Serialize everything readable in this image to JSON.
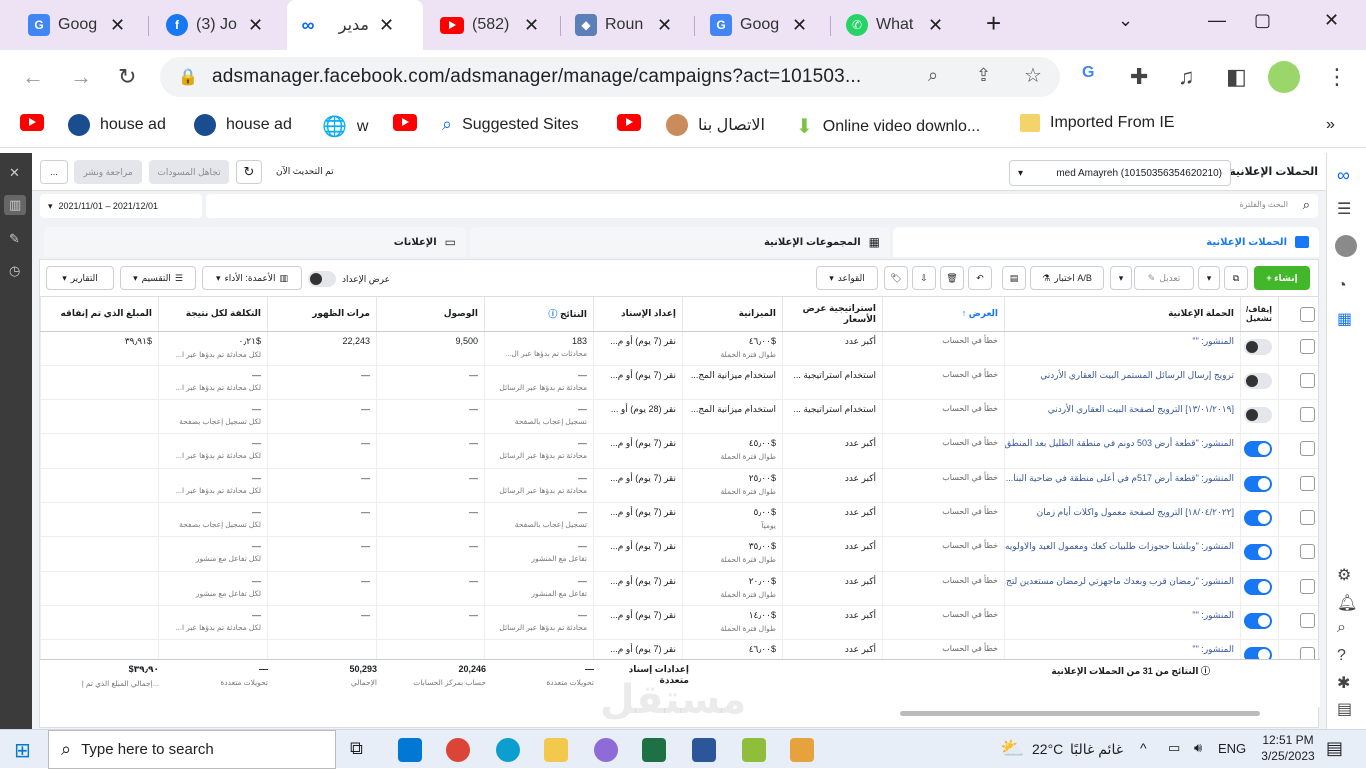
{
  "browser": {
    "tabs": [
      {
        "title": "Goog",
        "icon": "google-translate-icon"
      },
      {
        "title": "(3) Jo",
        "icon": "facebook-icon"
      },
      {
        "title": "مدير",
        "icon": "meta-icon",
        "active": true
      },
      {
        "title": "(582)",
        "icon": "youtube-icon"
      },
      {
        "title": "Roun",
        "icon": "cube-icon"
      },
      {
        "title": "Goog",
        "icon": "google-translate-icon"
      },
      {
        "title": "What",
        "icon": "whatsapp-icon"
      }
    ],
    "new_tab": "+",
    "url": "adsmanager.facebook.com/adsmanager/manage/campaigns?act=101503...",
    "bookmarks": [
      {
        "label": "",
        "icon": "youtube-icon"
      },
      {
        "label": "house ad",
        "icon": "house-ad-icon"
      },
      {
        "label": "house ad",
        "icon": "house-ad-icon"
      },
      {
        "label": "w",
        "icon": "globe-icon"
      },
      {
        "label": "",
        "icon": "youtube-icon"
      },
      {
        "label": "Suggested Sites",
        "icon": "search-icon"
      },
      {
        "label": "",
        "icon": "youtube-icon"
      },
      {
        "label": "الاتصال بنا",
        "icon": "avatar-icon"
      },
      {
        "label": "Online video downlo...",
        "icon": "download-icon"
      },
      {
        "label": "Imported From IE",
        "icon": "folder-icon"
      }
    ]
  },
  "app": {
    "section_title": "الحملات الإعلانية",
    "account": "med Amayreh (10150356354620210)",
    "updated": "تم التحديث الآن",
    "discard": "تجاهل المسودات",
    "review_publish": "مراجعة ونشر",
    "more": "...",
    "search_placeholder": "البحث والفلترة",
    "date_range": "2021/11/01 – 2021/12/01",
    "tabs": {
      "campaigns": "الحملات الإعلانية",
      "adsets": "المجموعات الإعلانية",
      "ads": "الإعلانات"
    },
    "toolbar": {
      "create": "+ إنشاء",
      "edit": "تعديل",
      "ab_test": "اختبار A/B",
      "rules": "القواعد",
      "view_setup": "عرض الإعداد",
      "columns": "الأعمدة: الأداء",
      "breakdown": "التقسيم",
      "reports": "التقارير"
    },
    "columns": [
      "إيقاف/ تشغيل",
      "الحملة الإعلانية",
      "العرض",
      "استراتيجية عرض الأسعار",
      "الميزانية",
      "إعداد الإسناد",
      "النتائج",
      "الوصول",
      "مرات الظهور",
      "التكلفة لكل نتيجة",
      "المبلغ الذي تم إنفاقه"
    ],
    "rows": [
      {
        "on": false,
        "name": "المنشور: \"\"",
        "delivery": "خطأ في الحساب",
        "bid": "أكبر عدد",
        "budget": "$٤٦٫٠٠",
        "budget_sub": "طوال فترة الحملة",
        "attribution": "نقر (7 يوم) أو م...",
        "results": "183",
        "results_sub": "محادثات تم بدؤها عبر ال...",
        "reach": "9,500",
        "impressions": "22,243",
        "cpr": "$٠٫٢١",
        "cpr_sub": "لكل محادثة تم بدؤها عبر ا...",
        "spent": "$٣٩٫٩١"
      },
      {
        "on": false,
        "name": "ترويج إرسال الرسائل المستمر البيت العقاري الأردني",
        "delivery": "خطأ في الحساب",
        "bid": "استخدام استراتيجية ...",
        "budget": "استخدام ميزانية المج...",
        "budget_sub": "",
        "attribution": "نقر (7 يوم) أو م...",
        "results": "—",
        "results_sub": "محادثة تم بدؤها عبر الرسائل",
        "reach": "—",
        "impressions": "—",
        "cpr": "—",
        "cpr_sub": "لكل محادثة تم بدؤها عبر ا...",
        "spent": ""
      },
      {
        "on": false,
        "name": "[١٣/٠١/٢٠١٩] الترويج لصفحة البيت العقاري الأردني",
        "delivery": "خطأ في الحساب",
        "bid": "استخدام استراتيجية ...",
        "budget": "استخدام ميزانية المج...",
        "budget_sub": "",
        "attribution": "نقر (28 يوم) أو ...",
        "results": "—",
        "results_sub": "تسجيل إعجاب بالصفحة",
        "reach": "—",
        "impressions": "—",
        "cpr": "—",
        "cpr_sub": "لكل تسجيل إعجاب بصفحة",
        "spent": ""
      },
      {
        "on": true,
        "name": "المنشور: \"قطعة أرض 503 دونم في منطقة الظليل بعد المنطق...",
        "delivery": "خطأ في الحساب",
        "bid": "أكبر عدد",
        "budget": "$٤٥٫٠٠",
        "budget_sub": "طوال فترة الحملة",
        "attribution": "نقر (7 يوم) أو م...",
        "results": "—",
        "results_sub": "محادثة تم بدؤها عبر الرسائل",
        "reach": "—",
        "impressions": "—",
        "cpr": "—",
        "cpr_sub": "لكل محادثة تم بدؤها عبر ا...",
        "spent": ""
      },
      {
        "on": true,
        "name": "المنشور: \"قطعة أرض 517م في أعلى منطقة في ضاحية البنا...",
        "delivery": "خطأ في الحساب",
        "bid": "أكبر عدد",
        "budget": "$٢٥٫٠٠",
        "budget_sub": "طوال فترة الحملة",
        "attribution": "نقر (7 يوم) أو م...",
        "results": "—",
        "results_sub": "محادثة تم بدؤها عبر الرسائل",
        "reach": "—",
        "impressions": "—",
        "cpr": "—",
        "cpr_sub": "لكل محادثة تم بدؤها عبر ا...",
        "spent": ""
      },
      {
        "on": true,
        "name": "[١٨/٠٤/٢٠٢٢] الترويج لصفحة معمول واكلات أيام زمان",
        "delivery": "خطأ في الحساب",
        "bid": "أكبر عدد",
        "budget": "$٥٫٠٠",
        "budget_sub": "يومياً",
        "attribution": "نقر (7 يوم) أو م...",
        "results": "—",
        "results_sub": "تسجيل إعجاب بالصفحة",
        "reach": "—",
        "impressions": "—",
        "cpr": "—",
        "cpr_sub": "لكل تسجيل إعجاب بصفحة",
        "spent": ""
      },
      {
        "on": true,
        "name": "المنشور: \"وبلشنا حجوزات طلبيات كعك ومعمول العيد والاولويه...",
        "delivery": "خطأ في الحساب",
        "bid": "أكبر عدد",
        "budget": "$٣٥٫٠٠",
        "budget_sub": "طوال فترة الحملة",
        "attribution": "نقر (7 يوم) أو م...",
        "results": "—",
        "results_sub": "تفاعل مع المنشور",
        "reach": "—",
        "impressions": "—",
        "cpr": "—",
        "cpr_sub": "لكل تفاعل مع منشور",
        "spent": ""
      },
      {
        "on": true,
        "name": "المنشور: \"رمضان قرب وبعدك ماجهزتي لرمضان مستعدين لتج...",
        "delivery": "خطأ في الحساب",
        "bid": "أكبر عدد",
        "budget": "$٢٠٫٠٠",
        "budget_sub": "طوال فترة الحملة",
        "attribution": "نقر (7 يوم) أو م...",
        "results": "—",
        "results_sub": "تفاعل مع المنشور",
        "reach": "—",
        "impressions": "—",
        "cpr": "—",
        "cpr_sub": "لكل تفاعل مع منشور",
        "spent": ""
      },
      {
        "on": true,
        "name": "المنشور: \"\"",
        "delivery": "خطأ في الحساب",
        "bid": "أكبر عدد",
        "budget": "$١٤٫٠٠",
        "budget_sub": "طوال فترة الحملة",
        "attribution": "نقر (7 يوم) أو م...",
        "results": "—",
        "results_sub": "محادثة تم بدؤها عبر الرسائل",
        "reach": "—",
        "impressions": "—",
        "cpr": "—",
        "cpr_sub": "لكل محادثة تم بدؤها عبر ا...",
        "spent": ""
      },
      {
        "on": true,
        "name": "المنشور: \"\"",
        "delivery": "خطأ في الحساب",
        "bid": "أكبر عدد",
        "budget": "$٤٦٫٠٠",
        "budget_sub": "",
        "attribution": "نقر (7 يوم) أو م...",
        "results": "",
        "results_sub": "",
        "reach": "",
        "impressions": "",
        "cpr": "",
        "cpr_sub": "",
        "spent": ""
      }
    ],
    "footer": {
      "results_label": "النتائج من 31 من الحملات الإعلانية",
      "attribution": "إعدادات إسناد متعددة",
      "results": "—",
      "results_sub": "تحويلات متعددة",
      "reach": "20,246",
      "reach_sub": "حساب بمركز الحسابات",
      "impressions": "50,293",
      "impressions_sub": "الإجمالي",
      "cpr": "—",
      "cpr_sub": "تحويلات متعددة",
      "spent": "$٣٩٫٩٠",
      "spent_sub": "إجمالي المبلغ الذي تم إ..."
    }
  },
  "taskbar": {
    "search": "Type here to search",
    "weather": "22°C",
    "weather_text": "غائم غالبًا",
    "lang": "ENG",
    "time": "12:51 PM",
    "date": "3/25/2023"
  },
  "watermark": "مستقل"
}
